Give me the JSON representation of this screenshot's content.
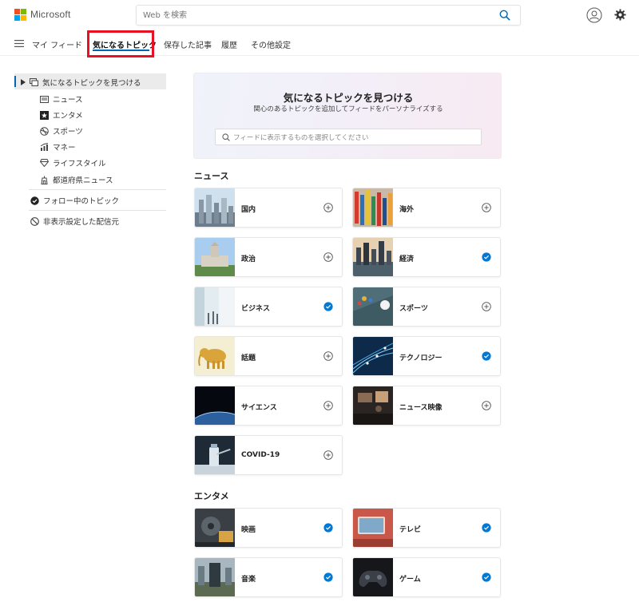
{
  "brand": {
    "name": "Microsoft",
    "logo_colors": [
      "#f25022",
      "#7fba00",
      "#00a4ef",
      "#ffb900"
    ]
  },
  "search": {
    "placeholder": "Web を検索"
  },
  "nav": {
    "items": [
      {
        "label": "マイ フィード",
        "active": false
      },
      {
        "label": "気になるトピック",
        "active": true
      },
      {
        "label": "保存した記事",
        "active": false
      },
      {
        "label": "履歴",
        "active": false
      },
      {
        "label": "その他設定",
        "active": false
      }
    ]
  },
  "sidebar": {
    "discover": "気になるトピックを見つける",
    "sub_items": [
      {
        "label": "ニュース",
        "icon": "newspaper-icon"
      },
      {
        "label": "エンタメ",
        "icon": "star-icon"
      },
      {
        "label": "スポーツ",
        "icon": "ball-icon"
      },
      {
        "label": "マネー",
        "icon": "chart-icon"
      },
      {
        "label": "ライフスタイル",
        "icon": "gem-icon"
      },
      {
        "label": "都道府県ニュース",
        "icon": "landmark-icon"
      }
    ],
    "following": "フォロー中のトピック",
    "hidden": "非表示設定した配信元"
  },
  "hero": {
    "title": "気になるトピックを見つける",
    "subtitle": "関心のあるトピックを追加してフィードをパーソナライズする",
    "search_placeholder": "フィードに表示するものを選択してください"
  },
  "sections": [
    {
      "title": "ニュース",
      "cards": [
        {
          "label": "国内",
          "followed": false
        },
        {
          "label": "海外",
          "followed": false
        },
        {
          "label": "政治",
          "followed": false
        },
        {
          "label": "経済",
          "followed": true
        },
        {
          "label": "ビジネス",
          "followed": true
        },
        {
          "label": "スポーツ",
          "followed": false
        },
        {
          "label": "話題",
          "followed": false
        },
        {
          "label": "テクノロジー",
          "followed": true
        },
        {
          "label": "サイエンス",
          "followed": false
        },
        {
          "label": "ニュース映像",
          "followed": false
        },
        {
          "label": "COVID-19",
          "followed": false
        }
      ]
    },
    {
      "title": "エンタメ",
      "cards": [
        {
          "label": "映画",
          "followed": true
        },
        {
          "label": "テレビ",
          "followed": true
        },
        {
          "label": "音楽",
          "followed": true
        },
        {
          "label": "ゲーム",
          "followed": true
        }
      ]
    }
  ],
  "colors": {
    "accent": "#0067b8",
    "check": "#0078d4",
    "highlight": "#e81123"
  }
}
